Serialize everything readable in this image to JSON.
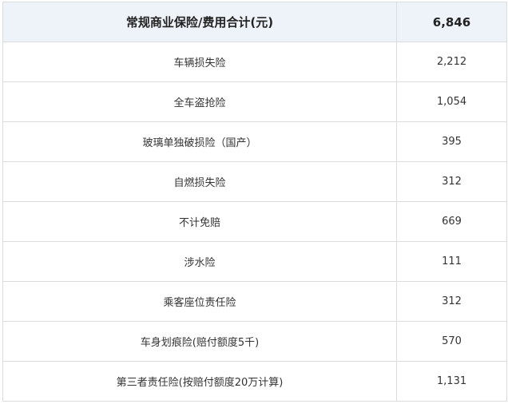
{
  "header": {
    "label": "常规商业保险/费用合计(元)",
    "value": "6,846"
  },
  "rows": [
    {
      "label": "车辆损失险",
      "value": "2,212"
    },
    {
      "label": "全车盗抢险",
      "value": "1,054"
    },
    {
      "label": "玻璃单独破损险（国产）",
      "value": "395"
    },
    {
      "label": "自燃损失险",
      "value": "312"
    },
    {
      "label": "不计免赔",
      "value": "669"
    },
    {
      "label": "涉水险",
      "value": "111"
    },
    {
      "label": "乘客座位责任险",
      "value": "312"
    },
    {
      "label": "车身划痕险(赔付额度5千)",
      "value": "570"
    },
    {
      "label": "第三者责任险(按赔付额度20万计算)",
      "value": "1,131"
    }
  ]
}
